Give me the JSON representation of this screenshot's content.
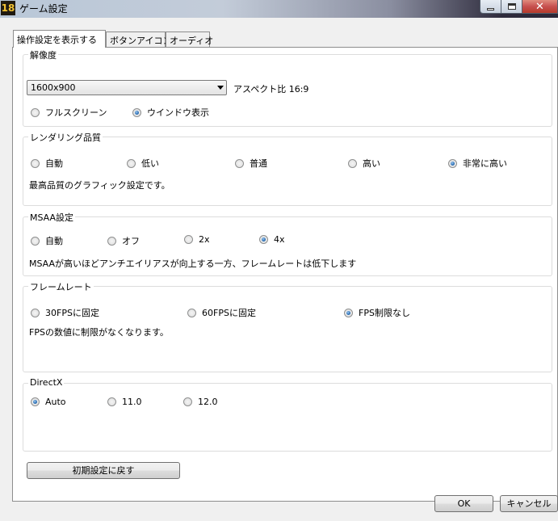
{
  "window": {
    "icon_text": "18",
    "title": "ゲーム設定"
  },
  "tabs": [
    {
      "label": "操作設定を表示する",
      "active": true
    },
    {
      "label": "ボタンアイコン",
      "active": false
    },
    {
      "label": "オーディオ",
      "active": false
    }
  ],
  "resolution": {
    "title": "解像度",
    "selected": "1600x900",
    "aspect_label": "アスペクト比 16:9",
    "modes": [
      {
        "label": "フルスクリーン",
        "checked": false
      },
      {
        "label": "ウインドウ表示",
        "checked": true
      }
    ]
  },
  "rendering": {
    "title": "レンダリング品質",
    "options": [
      {
        "label": "自動",
        "checked": false
      },
      {
        "label": "低い",
        "checked": false
      },
      {
        "label": "普通",
        "checked": false
      },
      {
        "label": "高い",
        "checked": false
      },
      {
        "label": "非常に高い",
        "checked": true
      }
    ],
    "description": "最高品質のグラフィック設定です。"
  },
  "msaa": {
    "title": "MSAA設定",
    "options": [
      {
        "label": "自動",
        "checked": false
      },
      {
        "label": "オフ",
        "checked": false
      },
      {
        "label": "2x",
        "checked": false
      },
      {
        "label": "4x",
        "checked": true
      }
    ],
    "description": "MSAAが高いほどアンチエイリアスが向上する一方、フレームレートは低下します"
  },
  "framerate": {
    "title": "フレームレート",
    "options": [
      {
        "label": "30FPSに固定",
        "checked": false
      },
      {
        "label": "60FPSに固定",
        "checked": false
      },
      {
        "label": "FPS制限なし",
        "checked": true
      }
    ],
    "description": "FPSの数値に制限がなくなります。"
  },
  "directx": {
    "title": "DirectX",
    "options": [
      {
        "label": "Auto",
        "checked": true
      },
      {
        "label": "11.0",
        "checked": false
      },
      {
        "label": "12.0",
        "checked": false
      }
    ]
  },
  "buttons": {
    "reset": "初期設定に戻す",
    "ok": "OK",
    "cancel": "キャンセル"
  }
}
